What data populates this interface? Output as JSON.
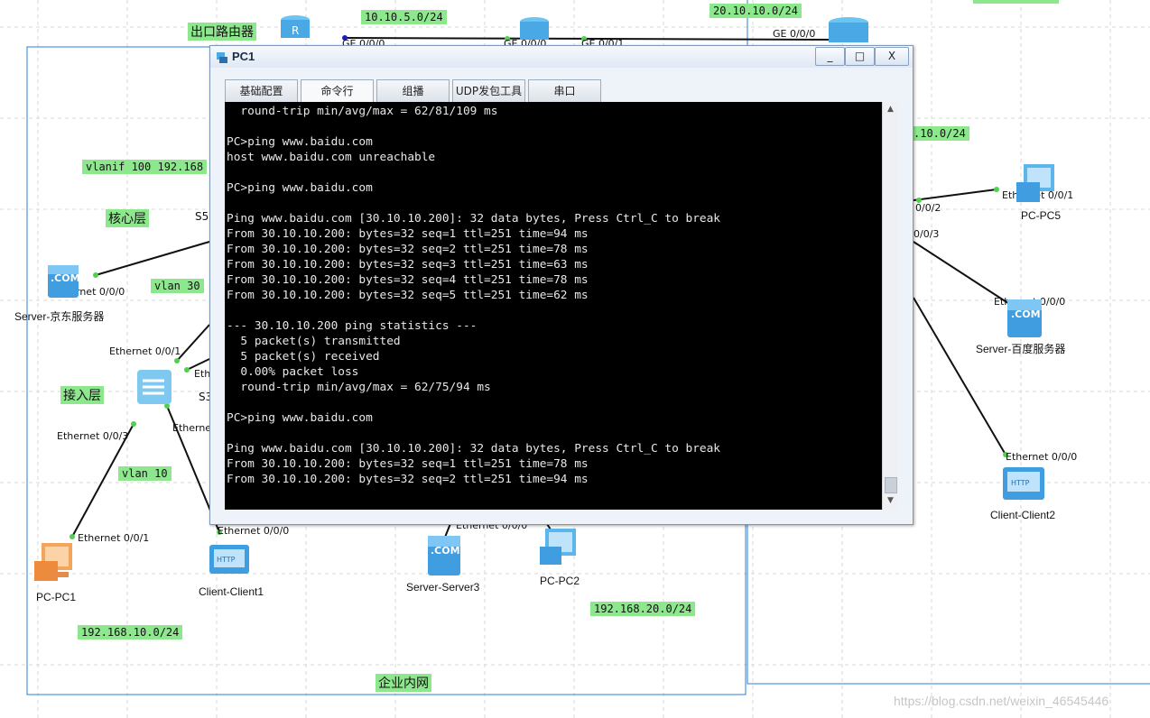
{
  "window": {
    "title": "PC1",
    "minimize_label": "_",
    "maximize_label": "□",
    "close_label": "X",
    "tabs": [
      "基础配置",
      "命令行",
      "组播",
      "UDP发包工具",
      "串口"
    ],
    "active_tab": "命令行"
  },
  "terminal": {
    "lines": [
      "  round-trip min/avg/max = 62/81/109 ms",
      "",
      "PC>ping www.baidu.com",
      "host www.baidu.com unreachable",
      "",
      "PC>ping www.baidu.com",
      "",
      "Ping www.baidu.com [30.10.10.200]: 32 data bytes, Press Ctrl_C to break",
      "From 30.10.10.200: bytes=32 seq=1 ttl=251 time=94 ms",
      "From 30.10.10.200: bytes=32 seq=2 ttl=251 time=78 ms",
      "From 30.10.10.200: bytes=32 seq=3 ttl=251 time=63 ms",
      "From 30.10.10.200: bytes=32 seq=4 ttl=251 time=78 ms",
      "From 30.10.10.200: bytes=32 seq=5 ttl=251 time=62 ms",
      "",
      "--- 30.10.10.200 ping statistics ---",
      "  5 packet(s) transmitted",
      "  5 packet(s) received",
      "  0.00% packet loss",
      "  round-trip min/avg/max = 62/75/94 ms",
      "",
      "PC>ping www.baidu.com",
      "",
      "Ping www.baidu.com [30.10.10.200]: 32 data bytes, Press Ctrl_C to break",
      "From 30.10.10.200: bytes=32 seq=1 ttl=251 time=78 ms",
      "From 30.10.10.200: bytes=32 seq=2 ttl=251 time=94 ms"
    ]
  },
  "topology": {
    "net_labels": {
      "net_10_10_5": "10.10.5.0/24",
      "net_20_10_10": "20.10.10.0/24",
      "net_partial_right": ".10.0/24",
      "vlanif100": "vlanif 100 192.168",
      "vlan30": "vlan 30",
      "vlan10": "vlan 10",
      "net_192_168_10": "192.168.10.0/24",
      "net_192_168_20": "192.168.20.0/24"
    },
    "zone_labels": {
      "exit_router": "出口路由器",
      "core_layer": "核心层",
      "access_layer": "接入层",
      "intranet": "企业内网"
    },
    "port_labels": {
      "ge000_a": "GE 0/0/0",
      "ge000_b": "GE 0/0/0",
      "ge001": "GE 0/0/1",
      "ge000_c": "GE 0/0/0",
      "eth000_jd": "Ethernet 0/0/0",
      "eth001_sw": "Ethernet 0/0/1",
      "eth_partial_1": "Eth",
      "eth003_sw": "Ethernet 0/0/3",
      "eth_partial_2": "Ethernet",
      "eth001_pc1": "Ethernet 0/0/1",
      "eth000_client1": "Ethernet 0/0/0",
      "eth000_server3": "Ethernet 0/0/0",
      "port_002": "0/0/2",
      "port_003": "0/0/3",
      "eth001_pc5": "Ethernet 0/0/1",
      "eth000_baidu": "Ethernet 0/0/0",
      "eth000_client2": "Ethernet 0/0/0",
      "core_partial": "S5",
      "access_partial": "S3"
    },
    "devices": {
      "jd_server": "Server-京东服务器",
      "pc1": "PC-PC1",
      "client1": "Client-Client1",
      "server3": "Server-Server3",
      "pc2": "PC-PC2",
      "pc5": "PC-PC5",
      "baidu_server": "Server-百度服务器",
      "client2": "Client-Client2"
    }
  },
  "watermark": "https://blog.csdn.net/weixin_46545446",
  "colors": {
    "label_bg": "#8de88d",
    "zone_border": "#2a7fd4",
    "grid": "#d9d9d9",
    "terminal_bg": "#000000",
    "terminal_fg": "#e8e8e8"
  }
}
